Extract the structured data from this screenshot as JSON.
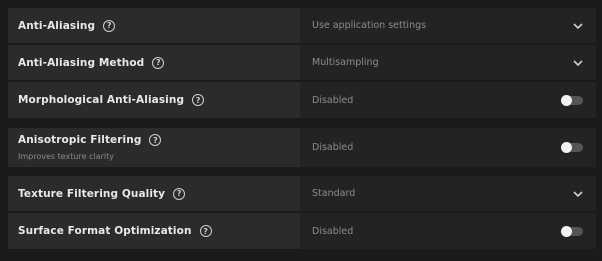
{
  "settings": [
    {
      "label": "Anti-Aliasing",
      "value": "Use application settings",
      "control": "dropdown",
      "icon": "chevron-down-icon"
    },
    {
      "label": "Anti-Aliasing Method",
      "value": "Multisampling",
      "control": "dropdown",
      "icon": "chevron-down-icon"
    },
    {
      "label": "Morphological Anti-Aliasing",
      "value": "Disabled",
      "control": "toggle",
      "enabled": false
    },
    {
      "label": "Anisotropic Filtering",
      "description": "Improves texture clarity",
      "value": "Disabled",
      "control": "toggle",
      "enabled": false
    },
    {
      "label": "Texture Filtering Quality",
      "value": "Standard",
      "control": "dropdown",
      "icon": "chevron-down-icon"
    },
    {
      "label": "Surface Format Optimization",
      "value": "Disabled",
      "control": "toggle",
      "enabled": false
    }
  ],
  "help_glyph": "?",
  "colors": {
    "background": "#1b1b1b",
    "label_cell": "#2b2b2b",
    "value_cell": "#232323",
    "label_text": "#e8e8e8",
    "value_text": "#8c8c8c",
    "toggle_track_off": "#555555",
    "toggle_knob": "#f2f2f2"
  }
}
